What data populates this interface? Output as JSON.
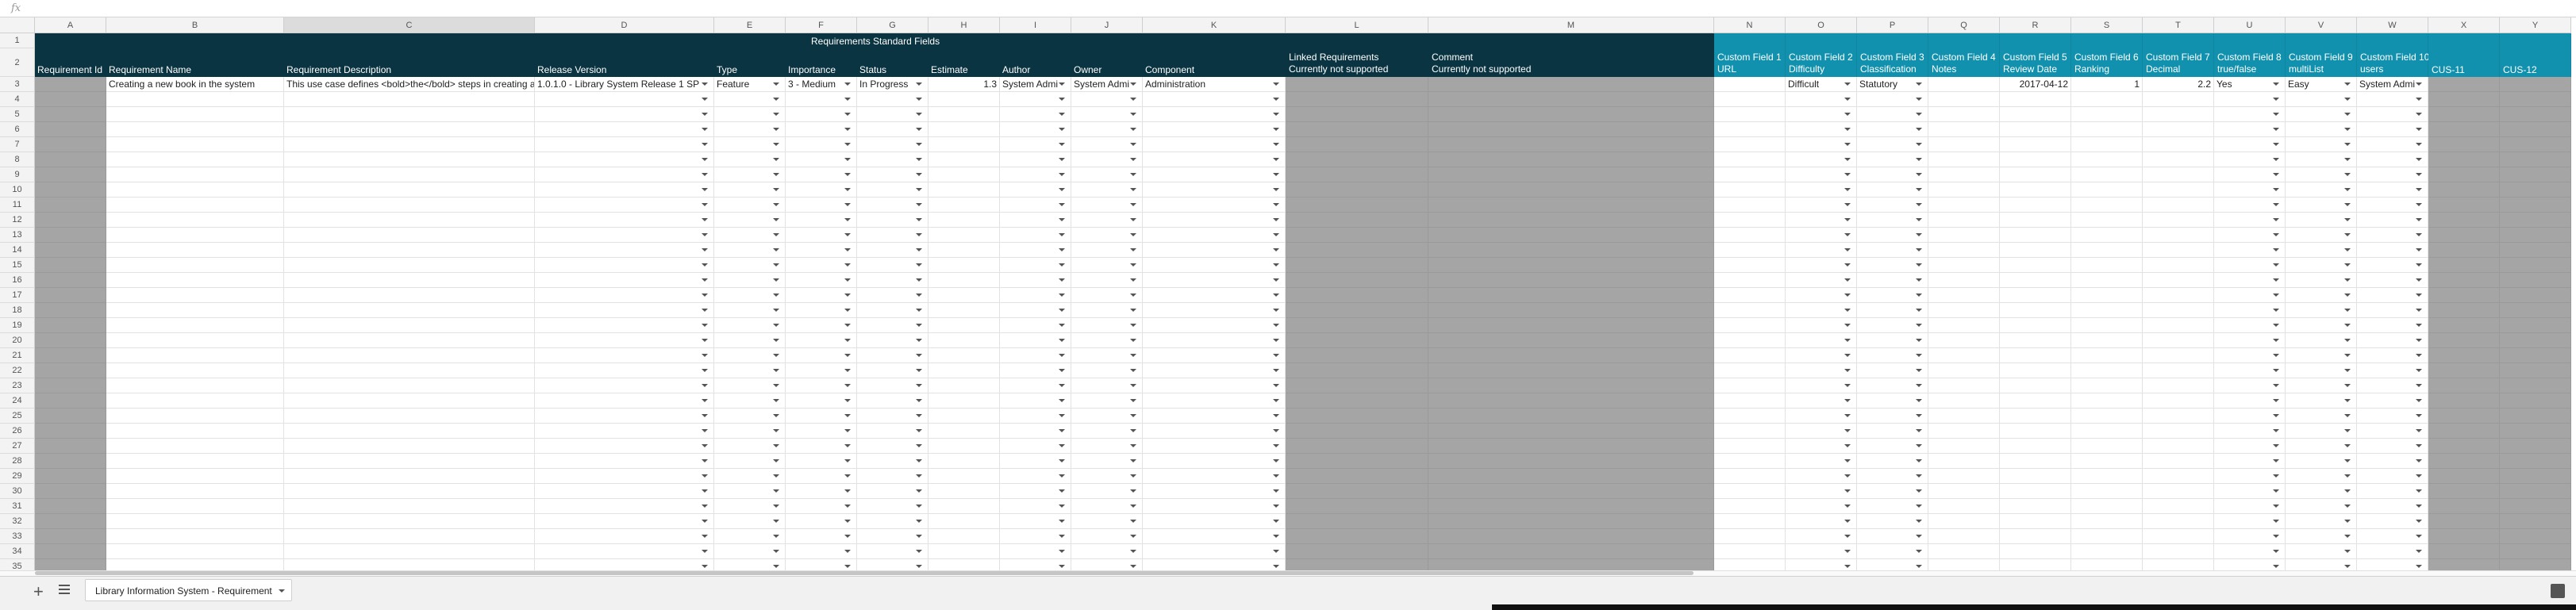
{
  "sheet": {
    "formula_bar_symbol": "fx",
    "columns": [
      "A",
      "B",
      "C",
      "D",
      "E",
      "F",
      "G",
      "H",
      "I",
      "J",
      "K",
      "L",
      "M",
      "N",
      "O",
      "P",
      "Q",
      "R",
      "S",
      "T",
      "U",
      "V",
      "W",
      "X",
      "Y"
    ],
    "rows": [
      "1",
      "2",
      "3",
      "4",
      "5",
      "6",
      "7",
      "8",
      "9",
      "10",
      "11",
      "12",
      "13",
      "14",
      "15",
      "16",
      "17",
      "18",
      "19",
      "20",
      "21",
      "22",
      "23",
      "24",
      "25",
      "26",
      "27",
      "28",
      "29",
      "30",
      "31",
      "32",
      "33",
      "34",
      "35"
    ],
    "group_header": "Requirements Standard Fields",
    "headers": {
      "A": "Requirement Id",
      "B": "Requirement Name",
      "C": "Requirement Description",
      "D": "Release Version",
      "E": "Type",
      "F": "Importance",
      "G": "Status",
      "H": "Estimate",
      "I": "Author",
      "J": "Owner",
      "K": "Component",
      "L1": "Linked Requirements",
      "L2": "Currently not supported",
      "M1": "Comment",
      "M2": "Currently not supported",
      "N1": "Custom Field 1",
      "N2": "URL",
      "O1": "Custom Field 2",
      "O2": "Difficulty",
      "P1": "Custom Field 3",
      "P2": "Classification",
      "Q1": "Custom Field 4",
      "Q2": "Notes",
      "R1": "Custom Field 5",
      "R2": "Review Date",
      "S1": "Custom Field 6",
      "S2": "Ranking",
      "T1": "Custom Field 7",
      "T2": "Decimal",
      "U1": "Custom Field 8",
      "U2": "true/false",
      "V1": "Custom Field 9",
      "V2": "multiList",
      "W1": "Custom Field 10",
      "W2": "users",
      "X": "CUS-11",
      "Y": "CUS-12"
    },
    "row3": {
      "B": "Creating a new book in the system",
      "C": "This use case defines <bold>the</bold> steps in creating a",
      "D": "1.0.1.0 - Library System Release 1 SP",
      "E": "Feature",
      "F": "3 - Medium",
      "G": "In Progress",
      "H": "1.3",
      "I": "System Admi",
      "J": "System Admi",
      "K": "Administration",
      "O": "Difficult",
      "P": "Statutory",
      "R": "2017-04-12",
      "S": "1",
      "T": "2.2",
      "U": "Yes",
      "V": "Easy",
      "W": "System Admi"
    },
    "tab_name": "Library Information System - Requirement",
    "colors": {
      "dark_header": "#0a3441",
      "teal_header": "#1191ad",
      "gray_readonly": "#a5a5a5"
    },
    "icons": {
      "add_sheet": "plus-icon",
      "all_sheets": "menu-icon",
      "explore": "explore-icon"
    }
  }
}
